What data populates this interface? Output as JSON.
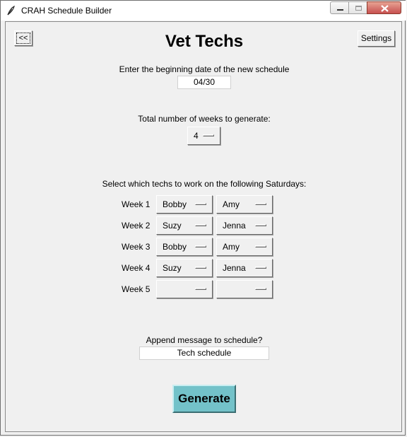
{
  "window": {
    "title": "CRAH Schedule Builder"
  },
  "header": {
    "back_label": "<<",
    "title": "Vet Techs",
    "settings_label": "Settings"
  },
  "start_date": {
    "prompt": "Enter the beginning date of the new schedule",
    "value": "04/30"
  },
  "weeks": {
    "prompt": "Total number of weeks to generate:",
    "value": "4"
  },
  "saturdays": {
    "prompt": "Select which techs to work on the following Saturdays:",
    "rows": [
      {
        "label": "Week 1",
        "tech1": "Bobby",
        "tech2": "Amy"
      },
      {
        "label": "Week 2",
        "tech1": "Suzy",
        "tech2": "Jenna"
      },
      {
        "label": "Week 3",
        "tech1": "Bobby",
        "tech2": "Amy"
      },
      {
        "label": "Week 4",
        "tech1": "Suzy",
        "tech2": "Jenna"
      },
      {
        "label": "Week 5",
        "tech1": "",
        "tech2": ""
      }
    ]
  },
  "message": {
    "prompt": "Append message to schedule?",
    "value": "Tech schedule"
  },
  "generate_label": "Generate",
  "colors": {
    "generate_bg": "#73c2c9",
    "titlebar_close": "#c75050"
  },
  "icons": {
    "app": "feather-icon",
    "minimize": "minimize-icon",
    "maximize": "maximize-icon",
    "close": "close-icon"
  }
}
